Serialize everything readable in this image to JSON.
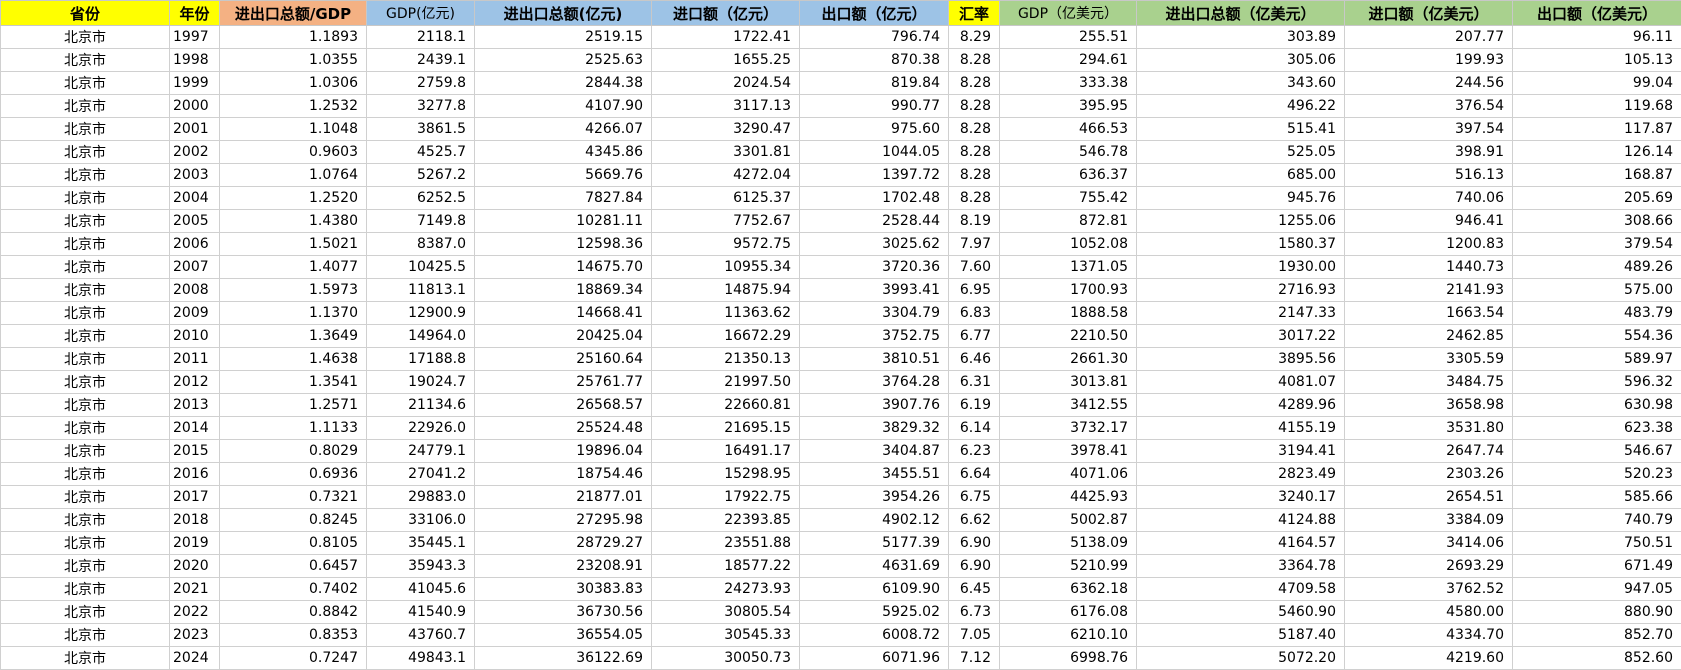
{
  "colors": {
    "yellow": "#FFFF00",
    "orange": "#F4B183",
    "blue": "#9DC3E6",
    "green": "#A9D18E"
  },
  "headers": [
    {
      "label": "省份",
      "color": "yellow"
    },
    {
      "label": "年份",
      "color": "yellow"
    },
    {
      "label": "进出口总额/GDP",
      "color": "orange"
    },
    {
      "label": "GDP(亿元)",
      "color": "blue"
    },
    {
      "label": "进出口总额(亿元)",
      "color": "blue"
    },
    {
      "label": "进口额（亿元）",
      "color": "blue"
    },
    {
      "label": "出口额（亿元）",
      "color": "blue"
    },
    {
      "label": "汇率",
      "color": "yellow"
    },
    {
      "label": "GDP（亿美元）",
      "color": "green"
    },
    {
      "label": "进出口总额（亿美元）",
      "color": "green"
    },
    {
      "label": "进口额（亿美元）",
      "color": "green"
    },
    {
      "label": "出口额（亿美元）",
      "color": "green"
    }
  ],
  "rows": [
    [
      "北京市",
      "1997",
      "1.1893",
      "2118.1",
      "2519.15",
      "1722.41",
      "796.74",
      "8.29",
      "255.51",
      "303.89",
      "207.77",
      "96.11"
    ],
    [
      "北京市",
      "1998",
      "1.0355",
      "2439.1",
      "2525.63",
      "1655.25",
      "870.38",
      "8.28",
      "294.61",
      "305.06",
      "199.93",
      "105.13"
    ],
    [
      "北京市",
      "1999",
      "1.0306",
      "2759.8",
      "2844.38",
      "2024.54",
      "819.84",
      "8.28",
      "333.38",
      "343.60",
      "244.56",
      "99.04"
    ],
    [
      "北京市",
      "2000",
      "1.2532",
      "3277.8",
      "4107.90",
      "3117.13",
      "990.77",
      "8.28",
      "395.95",
      "496.22",
      "376.54",
      "119.68"
    ],
    [
      "北京市",
      "2001",
      "1.1048",
      "3861.5",
      "4266.07",
      "3290.47",
      "975.60",
      "8.28",
      "466.53",
      "515.41",
      "397.54",
      "117.87"
    ],
    [
      "北京市",
      "2002",
      "0.9603",
      "4525.7",
      "4345.86",
      "3301.81",
      "1044.05",
      "8.28",
      "546.78",
      "525.05",
      "398.91",
      "126.14"
    ],
    [
      "北京市",
      "2003",
      "1.0764",
      "5267.2",
      "5669.76",
      "4272.04",
      "1397.72",
      "8.28",
      "636.37",
      "685.00",
      "516.13",
      "168.87"
    ],
    [
      "北京市",
      "2004",
      "1.2520",
      "6252.5",
      "7827.84",
      "6125.37",
      "1702.48",
      "8.28",
      "755.42",
      "945.76",
      "740.06",
      "205.69"
    ],
    [
      "北京市",
      "2005",
      "1.4380",
      "7149.8",
      "10281.11",
      "7752.67",
      "2528.44",
      "8.19",
      "872.81",
      "1255.06",
      "946.41",
      "308.66"
    ],
    [
      "北京市",
      "2006",
      "1.5021",
      "8387.0",
      "12598.36",
      "9572.75",
      "3025.62",
      "7.97",
      "1052.08",
      "1580.37",
      "1200.83",
      "379.54"
    ],
    [
      "北京市",
      "2007",
      "1.4077",
      "10425.5",
      "14675.70",
      "10955.34",
      "3720.36",
      "7.60",
      "1371.05",
      "1930.00",
      "1440.73",
      "489.26"
    ],
    [
      "北京市",
      "2008",
      "1.5973",
      "11813.1",
      "18869.34",
      "14875.94",
      "3993.41",
      "6.95",
      "1700.93",
      "2716.93",
      "2141.93",
      "575.00"
    ],
    [
      "北京市",
      "2009",
      "1.1370",
      "12900.9",
      "14668.41",
      "11363.62",
      "3304.79",
      "6.83",
      "1888.58",
      "2147.33",
      "1663.54",
      "483.79"
    ],
    [
      "北京市",
      "2010",
      "1.3649",
      "14964.0",
      "20425.04",
      "16672.29",
      "3752.75",
      "6.77",
      "2210.50",
      "3017.22",
      "2462.85",
      "554.36"
    ],
    [
      "北京市",
      "2011",
      "1.4638",
      "17188.8",
      "25160.64",
      "21350.13",
      "3810.51",
      "6.46",
      "2661.30",
      "3895.56",
      "3305.59",
      "589.97"
    ],
    [
      "北京市",
      "2012",
      "1.3541",
      "19024.7",
      "25761.77",
      "21997.50",
      "3764.28",
      "6.31",
      "3013.81",
      "4081.07",
      "3484.75",
      "596.32"
    ],
    [
      "北京市",
      "2013",
      "1.2571",
      "21134.6",
      "26568.57",
      "22660.81",
      "3907.76",
      "6.19",
      "3412.55",
      "4289.96",
      "3658.98",
      "630.98"
    ],
    [
      "北京市",
      "2014",
      "1.1133",
      "22926.0",
      "25524.48",
      "21695.15",
      "3829.32",
      "6.14",
      "3732.17",
      "4155.19",
      "3531.80",
      "623.38"
    ],
    [
      "北京市",
      "2015",
      "0.8029",
      "24779.1",
      "19896.04",
      "16491.17",
      "3404.87",
      "6.23",
      "3978.41",
      "3194.41",
      "2647.74",
      "546.67"
    ],
    [
      "北京市",
      "2016",
      "0.6936",
      "27041.2",
      "18754.46",
      "15298.95",
      "3455.51",
      "6.64",
      "4071.06",
      "2823.49",
      "2303.26",
      "520.23"
    ],
    [
      "北京市",
      "2017",
      "0.7321",
      "29883.0",
      "21877.01",
      "17922.75",
      "3954.26",
      "6.75",
      "4425.93",
      "3240.17",
      "2654.51",
      "585.66"
    ],
    [
      "北京市",
      "2018",
      "0.8245",
      "33106.0",
      "27295.98",
      "22393.85",
      "4902.12",
      "6.62",
      "5002.87",
      "4124.88",
      "3384.09",
      "740.79"
    ],
    [
      "北京市",
      "2019",
      "0.8105",
      "35445.1",
      "28729.27",
      "23551.88",
      "5177.39",
      "6.90",
      "5138.09",
      "4164.57",
      "3414.06",
      "750.51"
    ],
    [
      "北京市",
      "2020",
      "0.6457",
      "35943.3",
      "23208.91",
      "18577.22",
      "4631.69",
      "6.90",
      "5210.99",
      "3364.78",
      "2693.29",
      "671.49"
    ],
    [
      "北京市",
      "2021",
      "0.7402",
      "41045.6",
      "30383.83",
      "24273.93",
      "6109.90",
      "6.45",
      "6362.18",
      "4709.58",
      "3762.52",
      "947.05"
    ],
    [
      "北京市",
      "2022",
      "0.8842",
      "41540.9",
      "36730.56",
      "30805.54",
      "5925.02",
      "6.73",
      "6176.08",
      "5460.90",
      "4580.00",
      "880.90"
    ],
    [
      "北京市",
      "2023",
      "0.8353",
      "43760.7",
      "36554.05",
      "30545.33",
      "6008.72",
      "7.05",
      "6210.10",
      "5187.40",
      "4334.70",
      "852.70"
    ],
    [
      "北京市",
      "2024",
      "0.7247",
      "49843.1",
      "36122.69",
      "30050.73",
      "6071.96",
      "7.12",
      "6998.76",
      "5072.20",
      "4219.60",
      "852.60"
    ]
  ]
}
